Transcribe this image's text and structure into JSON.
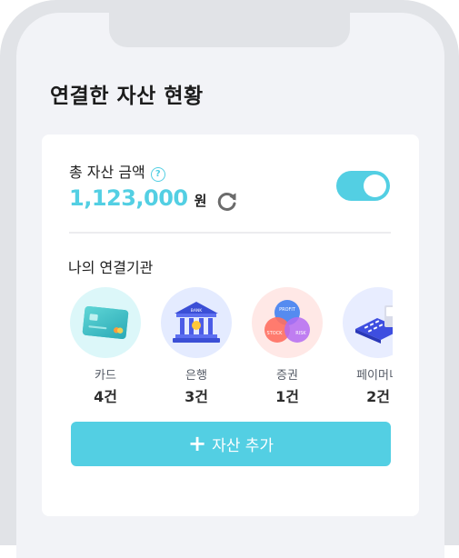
{
  "page_title": "연결한 자산 현황",
  "asset_summary": {
    "label": "총 자산 금액",
    "help_icon_text": "?",
    "amount": "1,123,000",
    "unit": "원",
    "toggle_on": true
  },
  "institutions": {
    "title": "나의 연결기관",
    "items": [
      {
        "name": "카드",
        "count": "4건",
        "icon": "credit-card-icon"
      },
      {
        "name": "은행",
        "count": "3건",
        "icon": "bank-building-icon"
      },
      {
        "name": "증권",
        "count": "1건",
        "icon": "securities-venn-icon"
      },
      {
        "name": "페이머니",
        "count": "2건",
        "icon": "pay-keypad-icon"
      }
    ],
    "securities_labels": {
      "top": "PROFIT",
      "left": "STOCK",
      "right": "RISK"
    },
    "bank_label": "BANK"
  },
  "add_button": {
    "label": "자산 추가",
    "icon": "plus-icon"
  },
  "colors": {
    "accent": "#53cfe3",
    "background": "#f2f3f7",
    "frame": "#e1e3e7",
    "text": "#1f1f1f"
  }
}
